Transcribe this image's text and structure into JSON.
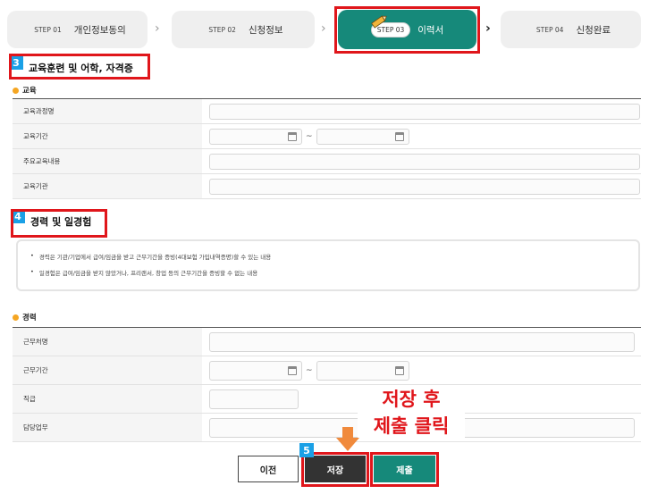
{
  "steps": [
    {
      "pill": "STEP 01",
      "label": "개인정보동의"
    },
    {
      "pill": "STEP 02",
      "label": "신청정보"
    },
    {
      "pill": "STEP 03",
      "label": "이력서"
    },
    {
      "pill": "STEP 04",
      "label": "신청완료"
    }
  ],
  "section3": {
    "badge": "3",
    "title": "교육훈련 및 어학, 자격증"
  },
  "education": {
    "title": "교육",
    "rows": [
      "교육과정명",
      "교육기간",
      "주요교육내용",
      "교육기관"
    ],
    "date_sep": "~"
  },
  "section4": {
    "badge": "4",
    "title": "경력 및 일경험"
  },
  "notice": [
    "경력은 기관/기업에서 급여/임금을 받고 근무기간을 증빙(4대보험 가입내역증명)할 수 있는 내용",
    "일경험은 급여/임금을 받지 않았거나, 프리랜서, 창업 등의 근무기간을 증빙할 수 없는 내용"
  ],
  "career": {
    "title": "경력",
    "rows": [
      "근무처명",
      "근무기간",
      "직급",
      "담당업무"
    ],
    "date_sep": "~"
  },
  "annotation": {
    "line1": "저장 후",
    "line2": "제출 클릭"
  },
  "step5_badge": "5",
  "buttons": {
    "prev": "이전",
    "save": "저장",
    "submit": "제출"
  },
  "colors": {
    "accent": "#16897a",
    "highlight": "#e0161b",
    "badge": "#1aa0e6",
    "save": "#333333"
  }
}
